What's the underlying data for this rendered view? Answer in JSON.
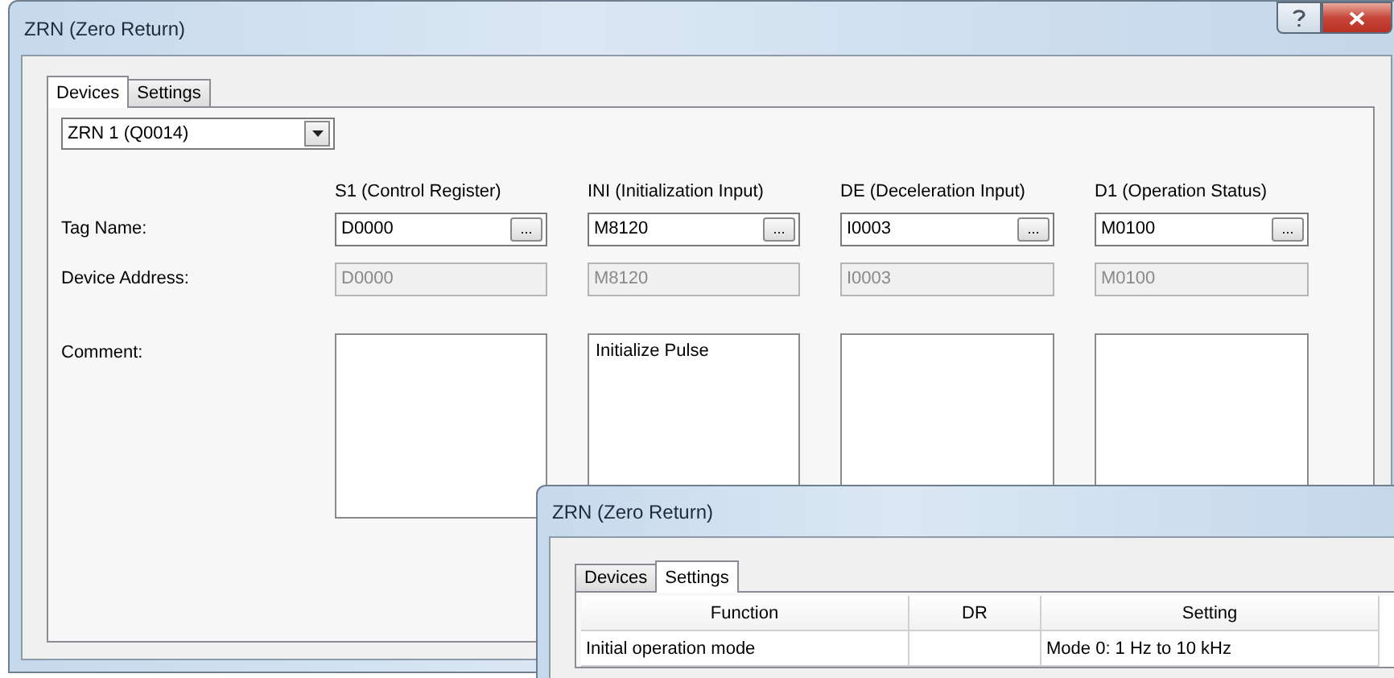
{
  "main_window": {
    "title": "ZRN (Zero Return)",
    "tabs": [
      {
        "label": "Devices",
        "selected": true
      },
      {
        "label": "Settings",
        "selected": false
      }
    ],
    "instance_dropdown": {
      "value": "ZRN 1 (Q0014)"
    },
    "row_labels": [
      "Tag Name:",
      "Device Address:",
      "Comment:"
    ],
    "operands": [
      {
        "header": "S1 (Control Register)",
        "tag_name": "D0000",
        "browse": "...",
        "device_address": "D0000"
      },
      {
        "header": "INI (Initialization Input)",
        "tag_name": "M8120",
        "browse": "...",
        "device_address": "M8120",
        "comment": "Initialize Pulse"
      },
      {
        "header": "DE (Deceleration Input)",
        "tag_name": "I0003",
        "browse": "...",
        "device_address": "I0003"
      },
      {
        "header": "D1 (Operation Status)",
        "tag_name": "M0100",
        "browse": "...",
        "device_address": "M0100"
      }
    ]
  },
  "second_window": {
    "title": "ZRN (Zero Return)",
    "tabs": [
      {
        "label": "Devices",
        "selected": false
      },
      {
        "label": "Settings",
        "selected": true
      }
    ],
    "table": {
      "columns": [
        "Function",
        "DR",
        "Setting"
      ],
      "rows": [
        [
          "Initial operation mode",
          "",
          "Mode 0: 1 Hz to 10 kHz"
        ]
      ]
    }
  }
}
